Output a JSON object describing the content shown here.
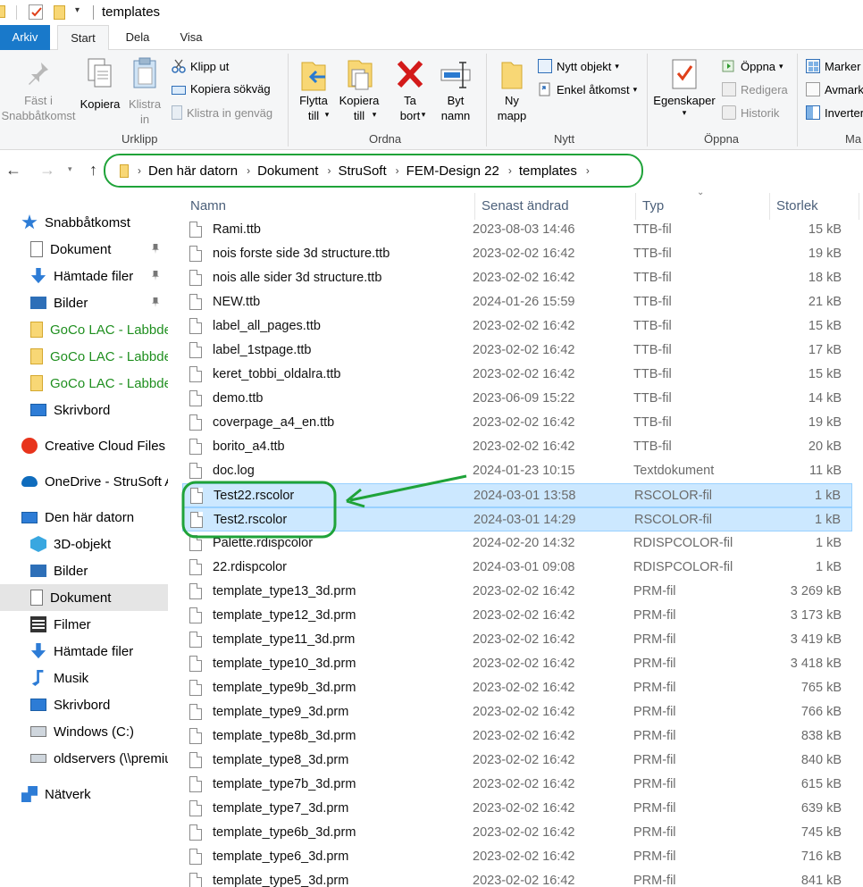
{
  "window": {
    "title": "templates"
  },
  "tabs": [
    {
      "label": "Arkiv"
    },
    {
      "label": "Start"
    },
    {
      "label": "Dela"
    },
    {
      "label": "Visa"
    }
  ],
  "ribbon": {
    "urklipp": {
      "group_label": "Urklipp",
      "pin": "Fäst i Snabbåtkomst",
      "copy": "Kopiera",
      "paste": "Klistra in",
      "cut": "Klipp ut",
      "copy_path": "Kopiera sökväg",
      "paste_shortcut": "Klistra in genväg"
    },
    "ordna": {
      "group_label": "Ordna",
      "move": "Flytta till",
      "copy_to": "Kopiera till",
      "delete": "Ta bort",
      "rename": "Byt namn"
    },
    "nytt": {
      "group_label": "Nytt",
      "new_folder": "Ny mapp",
      "new_item": "Nytt objekt",
      "easy_access": "Enkel åtkomst"
    },
    "oppna": {
      "group_label": "Öppna",
      "properties": "Egenskaper",
      "open": "Öppna",
      "edit": "Redigera",
      "history": "Historik"
    },
    "markera": {
      "group_label": "Ma",
      "select_all": "Marker",
      "select_none": "Avmark",
      "invert": "Inverter"
    }
  },
  "address": {
    "crumbs": [
      "Den här datorn",
      "Dokument",
      "StruSoft",
      "FEM-Design 22",
      "templates"
    ]
  },
  "nav": [
    {
      "label": "Snabbåtkomst",
      "icon": "star-icon",
      "indent": 0,
      "pinned": false,
      "green": false
    },
    {
      "label": "Dokument",
      "icon": "document-icon",
      "indent": 1,
      "pinned": true,
      "green": false
    },
    {
      "label": "Hämtade filer",
      "icon": "download-icon",
      "indent": 1,
      "pinned": true,
      "green": false
    },
    {
      "label": "Bilder",
      "icon": "pictures-icon",
      "indent": 1,
      "pinned": true,
      "green": false
    },
    {
      "label": "GoCo LAC - Labbde",
      "icon": "folder-icon",
      "indent": 1,
      "pinned": false,
      "green": true
    },
    {
      "label": "GoCo LAC - Labbde",
      "icon": "folder-icon",
      "indent": 1,
      "pinned": false,
      "green": true
    },
    {
      "label": "GoCo LAC - Labbde",
      "icon": "folder-icon",
      "indent": 1,
      "pinned": false,
      "green": true
    },
    {
      "label": "Skrivbord",
      "icon": "desktop-icon",
      "indent": 1,
      "pinned": false,
      "green": false
    },
    {
      "label": "Creative Cloud Files",
      "icon": "creative-cloud-icon",
      "indent": 0,
      "pinned": false,
      "green": false
    },
    {
      "label": "OneDrive - StruSoft A",
      "icon": "onedrive-icon",
      "indent": 0,
      "pinned": false,
      "green": false
    },
    {
      "label": "Den här datorn",
      "icon": "computer-icon",
      "indent": 0,
      "pinned": false,
      "green": false
    },
    {
      "label": "3D-objekt",
      "icon": "cube-icon",
      "indent": 1,
      "pinned": false,
      "green": false
    },
    {
      "label": "Bilder",
      "icon": "pictures-icon",
      "indent": 1,
      "pinned": false,
      "green": false
    },
    {
      "label": "Dokument",
      "icon": "document-icon",
      "indent": 1,
      "pinned": false,
      "green": false,
      "selected": true
    },
    {
      "label": "Filmer",
      "icon": "film-icon",
      "indent": 1,
      "pinned": false,
      "green": false
    },
    {
      "label": "Hämtade filer",
      "icon": "download-icon",
      "indent": 1,
      "pinned": false,
      "green": false
    },
    {
      "label": "Musik",
      "icon": "music-icon",
      "indent": 1,
      "pinned": false,
      "green": false
    },
    {
      "label": "Skrivbord",
      "icon": "desktop-icon",
      "indent": 1,
      "pinned": false,
      "green": false
    },
    {
      "label": "Windows (C:)",
      "icon": "drive-icon",
      "indent": 1,
      "pinned": false,
      "green": false
    },
    {
      "label": "oldservers (\\\\premiu",
      "icon": "network-drive-icon",
      "indent": 1,
      "pinned": false,
      "green": false
    },
    {
      "label": "Nätverk",
      "icon": "network-icon",
      "indent": 0,
      "pinned": false,
      "green": false
    }
  ],
  "columns": {
    "name": "Namn",
    "date": "Senast ändrad",
    "type": "Typ",
    "size": "Storlek"
  },
  "files": [
    {
      "name": "Rami.ttb",
      "date": "2023-08-03 14:46",
      "type": "TTB-fil",
      "size": "15 kB"
    },
    {
      "name": "nois forste side 3d structure.ttb",
      "date": "2023-02-02 16:42",
      "type": "TTB-fil",
      "size": "19 kB"
    },
    {
      "name": "nois alle sider 3d structure.ttb",
      "date": "2023-02-02 16:42",
      "type": "TTB-fil",
      "size": "18 kB"
    },
    {
      "name": "NEW.ttb",
      "date": "2024-01-26 15:59",
      "type": "TTB-fil",
      "size": "21 kB"
    },
    {
      "name": "label_all_pages.ttb",
      "date": "2023-02-02 16:42",
      "type": "TTB-fil",
      "size": "15 kB"
    },
    {
      "name": "label_1stpage.ttb",
      "date": "2023-02-02 16:42",
      "type": "TTB-fil",
      "size": "17 kB"
    },
    {
      "name": "keret_tobbi_oldalra.ttb",
      "date": "2023-02-02 16:42",
      "type": "TTB-fil",
      "size": "15 kB"
    },
    {
      "name": "demo.ttb",
      "date": "2023-06-09 15:22",
      "type": "TTB-fil",
      "size": "14 kB"
    },
    {
      "name": "coverpage_a4_en.ttb",
      "date": "2023-02-02 16:42",
      "type": "TTB-fil",
      "size": "19 kB"
    },
    {
      "name": "borito_a4.ttb",
      "date": "2023-02-02 16:42",
      "type": "TTB-fil",
      "size": "20 kB"
    },
    {
      "name": "doc.log",
      "date": "2024-01-23 10:15",
      "type": "Textdokument",
      "size": "11 kB"
    },
    {
      "name": "Test22.rscolor",
      "date": "2024-03-01 13:58",
      "type": "RSCOLOR-fil",
      "size": "1 kB",
      "selected": true
    },
    {
      "name": "Test2.rscolor",
      "date": "2024-03-01 14:29",
      "type": "RSCOLOR-fil",
      "size": "1 kB",
      "selected": true
    },
    {
      "name": "Palette.rdispcolor",
      "date": "2024-02-20 14:32",
      "type": "RDISPCOLOR-fil",
      "size": "1 kB"
    },
    {
      "name": "22.rdispcolor",
      "date": "2024-03-01 09:08",
      "type": "RDISPCOLOR-fil",
      "size": "1 kB"
    },
    {
      "name": "template_type13_3d.prm",
      "date": "2023-02-02 16:42",
      "type": "PRM-fil",
      "size": "3 269 kB"
    },
    {
      "name": "template_type12_3d.prm",
      "date": "2023-02-02 16:42",
      "type": "PRM-fil",
      "size": "3 173 kB"
    },
    {
      "name": "template_type11_3d.prm",
      "date": "2023-02-02 16:42",
      "type": "PRM-fil",
      "size": "3 419 kB"
    },
    {
      "name": "template_type10_3d.prm",
      "date": "2023-02-02 16:42",
      "type": "PRM-fil",
      "size": "3 418 kB"
    },
    {
      "name": "template_type9b_3d.prm",
      "date": "2023-02-02 16:42",
      "type": "PRM-fil",
      "size": "765 kB"
    },
    {
      "name": "template_type9_3d.prm",
      "date": "2023-02-02 16:42",
      "type": "PRM-fil",
      "size": "766 kB"
    },
    {
      "name": "template_type8b_3d.prm",
      "date": "2023-02-02 16:42",
      "type": "PRM-fil",
      "size": "838 kB"
    },
    {
      "name": "template_type8_3d.prm",
      "date": "2023-02-02 16:42",
      "type": "PRM-fil",
      "size": "840 kB"
    },
    {
      "name": "template_type7b_3d.prm",
      "date": "2023-02-02 16:42",
      "type": "PRM-fil",
      "size": "615 kB"
    },
    {
      "name": "template_type7_3d.prm",
      "date": "2023-02-02 16:42",
      "type": "PRM-fil",
      "size": "639 kB"
    },
    {
      "name": "template_type6b_3d.prm",
      "date": "2023-02-02 16:42",
      "type": "PRM-fil",
      "size": "745 kB"
    },
    {
      "name": "template_type6_3d.prm",
      "date": "2023-02-02 16:42",
      "type": "PRM-fil",
      "size": "716 kB"
    },
    {
      "name": "template_type5_3d.prm",
      "date": "2023-02-02 16:42",
      "type": "PRM-fil",
      "size": "841 kB"
    }
  ],
  "colors": {
    "accent": "#1979ca",
    "selection": "#cce8ff",
    "selection_border": "#99d1ff",
    "annotation": "#1fa339",
    "folder": "#f8d775"
  }
}
